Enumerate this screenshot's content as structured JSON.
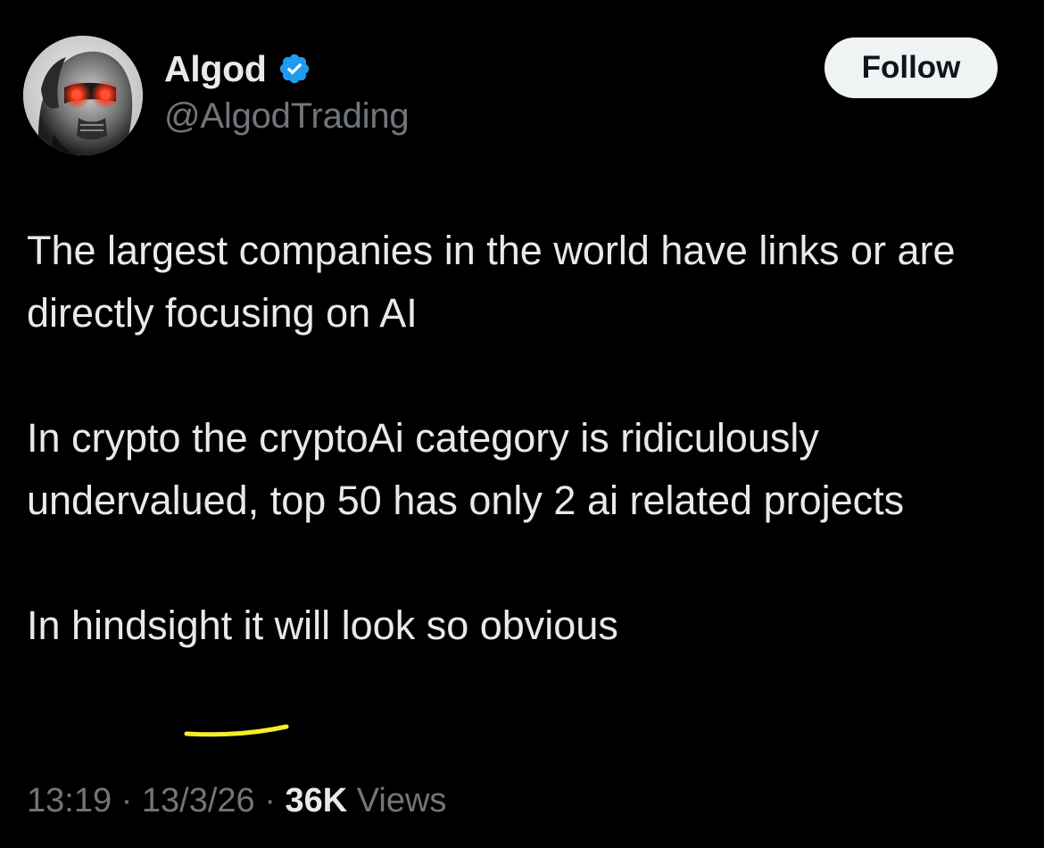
{
  "author": {
    "display_name": "Algod",
    "handle": "@AlgodTrading",
    "verified": true,
    "avatar_icon": "robot-face-avatar"
  },
  "follow_button": {
    "label": "Follow"
  },
  "tweet": {
    "paragraphs": [
      "The largest companies in the world have links or are directly focusing on AI",
      "In crypto the cryptoAi category is ridiculously undervalued, top 50 has only 2 ai related projects",
      "In hindsight it will look so obvious"
    ]
  },
  "meta": {
    "time": "13:19",
    "separator": " · ",
    "date": "13/3/26",
    "views_count": "36K",
    "views_label": " Views"
  },
  "colors": {
    "background": "#000000",
    "text_primary": "#e7e9ea",
    "text_secondary": "#71767b",
    "verified_badge": "#1d9bf0",
    "follow_bg": "#eff3f4",
    "highlight_mark": "#f5ee2b"
  }
}
